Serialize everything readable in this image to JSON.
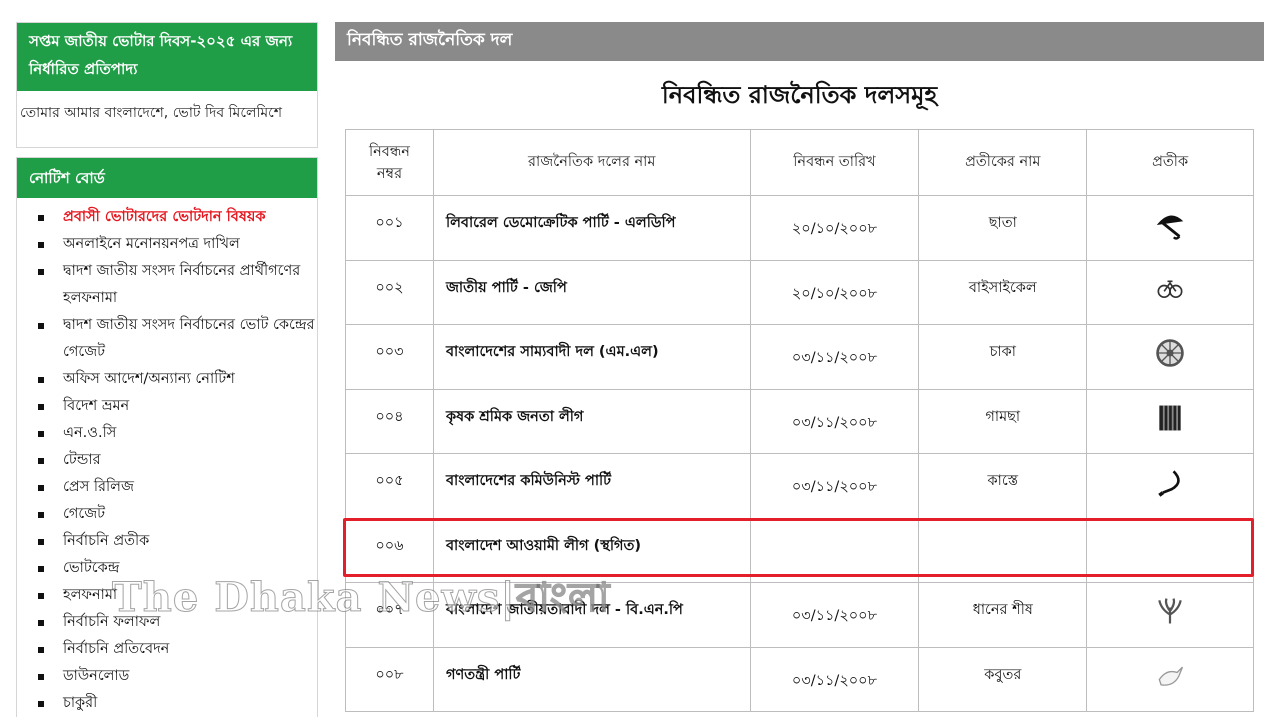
{
  "sidebar": {
    "banner": {
      "title": "সপ্তম জাতীয় ভোটার দিবস-২০২৫ এর জন্য নির্ধারিত প্রতিপাদ্য",
      "slogan": "তোমার আমার বাংলাদেশে, ভোট দিব মিলেমিশে"
    },
    "notice_board": {
      "title": "নোটিশ বোর্ড",
      "items": [
        "প্রবাসী ভোটারদের ভোটদান বিষয়ক",
        "অনলাইনে মনোনয়নপত্র দাখিল",
        "দ্বাদশ জাতীয় সংসদ নির্বাচনের প্রার্থীগণের হলফনামা",
        "দ্বাদশ জাতীয় সংসদ নির্বাচনের ভোট কেন্দ্রের গেজেট",
        "অফিস আদেশ/অন্যান্য নোটিশ",
        "বিদেশ ভ্রমন",
        "এন.ও.সি",
        "টেন্ডার",
        "প্রেস রিলিজ",
        "গেজেট",
        "নির্বাচনি প্রতীক",
        "ভোটকেন্দ্র",
        "হলফনামা",
        "নির্বাচনি ফলাফল",
        "নির্বাচনি প্রতিবেদন",
        "ডাউনলোড",
        "চাকুরী"
      ]
    }
  },
  "main": {
    "header": "নিবন্ধিত রাজনৈতিক দল",
    "title": "নিবন্ধিত রাজনৈতিক দলসমূহ",
    "columns": {
      "no": "নিবন্ধন নম্বর",
      "name": "রাজনৈতিক দলের নাম",
      "date": "নিবন্ধন তারিখ",
      "symbol_name": "প্রতীকের নাম",
      "symbol": "প্রতীক"
    },
    "rows": [
      {
        "no": "০০১",
        "name": "লিবারেল ডেমোক্রেটিক পার্টি - এলডিপি",
        "date": "২০/১০/২০০৮",
        "symbol_name": "ছাতা",
        "icon": "umbrella-icon"
      },
      {
        "no": "০০২",
        "name": "জাতীয় পার্টি - জেপি",
        "date": "২০/১০/২০০৮",
        "symbol_name": "বাইসাইকেল",
        "icon": "bicycle-icon"
      },
      {
        "no": "০০৩",
        "name": "বাংলাদেশের সাম্যবাদী দল (এম.এল)",
        "date": "০৩/১১/২০০৮",
        "symbol_name": "চাকা",
        "icon": "wheel-icon"
      },
      {
        "no": "০০৪",
        "name": "কৃষক শ্রমিক জনতা লীগ",
        "date": "০৩/১১/২০০৮",
        "symbol_name": "গামছা",
        "icon": "towel-icon"
      },
      {
        "no": "০০৫",
        "name": "বাংলাদেশের কমিউনিস্ট পার্টি",
        "date": "০৩/১১/২০০৮",
        "symbol_name": "কাস্তে",
        "icon": "sickle-icon"
      },
      {
        "no": "০০৬",
        "name": "বাংলাদেশ আওয়ামী লীগ (স্থগিত)",
        "date": "",
        "symbol_name": "",
        "icon": ""
      },
      {
        "no": "০০৭",
        "name": "বাংলাদেশ জাতীয়তাবাদী দল - বি.এন.পি",
        "date": "০৩/১১/২০০৮",
        "symbol_name": "ধানের শীষ",
        "icon": "paddy-sheaf-icon"
      },
      {
        "no": "০০৮",
        "name": "গণতন্ত্রী পার্টি",
        "date": "০৩/১১/২০০৮",
        "symbol_name": "কবুতর",
        "icon": "pigeon-icon"
      }
    ]
  },
  "watermark": "The Dhaka News|বাংলা",
  "colors": {
    "green": "#1f9d47",
    "gray_header": "#8a8a8a",
    "highlight_red": "#e3202a",
    "link_red": "#e5161e"
  }
}
